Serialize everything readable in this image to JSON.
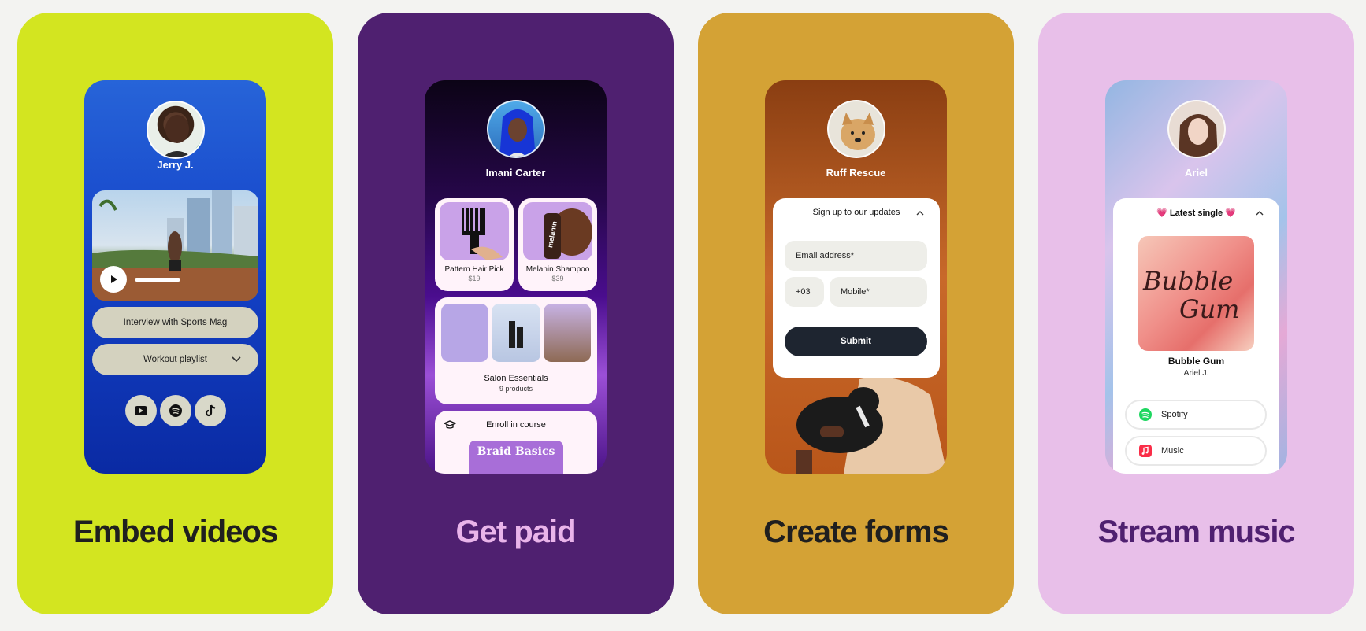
{
  "cards": [
    {
      "heading": "Embed videos",
      "bg": "#d3e520",
      "heading_color": "#1f1f1f",
      "profile": {
        "name": "Jerry J."
      },
      "video": {
        "play_icon": "play-icon"
      },
      "buttons": [
        {
          "label": "Interview with Sports Mag"
        },
        {
          "label": "Workout playlist"
        }
      ],
      "socials": [
        "youtube-icon",
        "spotify-icon",
        "tiktok-icon"
      ]
    },
    {
      "heading": "Get paid",
      "bg": "#4f2070",
      "heading_color": "#e9b4ea",
      "profile": {
        "name": "Imani Carter"
      },
      "products": [
        {
          "title": "Pattern Hair Pick",
          "price": "$19",
          "image_text": ""
        },
        {
          "title": "Melanin Shampoo",
          "price": "$39",
          "image_text": "melanin"
        }
      ],
      "collection": {
        "title": "Salon Essentials",
        "subtitle": "9 products"
      },
      "course": {
        "label": "Enroll in course",
        "cover_text": "Braid Basics"
      }
    },
    {
      "heading": "Create forms",
      "bg": "#d4a235",
      "heading_color": "#1f1f1f",
      "profile": {
        "name": "Ruff Rescue"
      },
      "form": {
        "title": "Sign up to our updates",
        "email_placeholder": "Email address*",
        "country_code": "+03",
        "mobile_placeholder": "Mobile*",
        "submit_label": "Submit"
      }
    },
    {
      "heading": "Stream music",
      "bg": "#e8bfe9",
      "heading_color": "#4f2070",
      "profile": {
        "name": "Ariel"
      },
      "single": {
        "header": "💗 Latest single 💗",
        "cover_text_1": "Bubble",
        "cover_text_2": "Gum",
        "title": "Bubble Gum",
        "artist": "Ariel J."
      },
      "services": [
        {
          "label": "Spotify",
          "icon": "spotify-icon"
        },
        {
          "label": "Music",
          "icon": "apple-music-icon"
        }
      ]
    }
  ]
}
